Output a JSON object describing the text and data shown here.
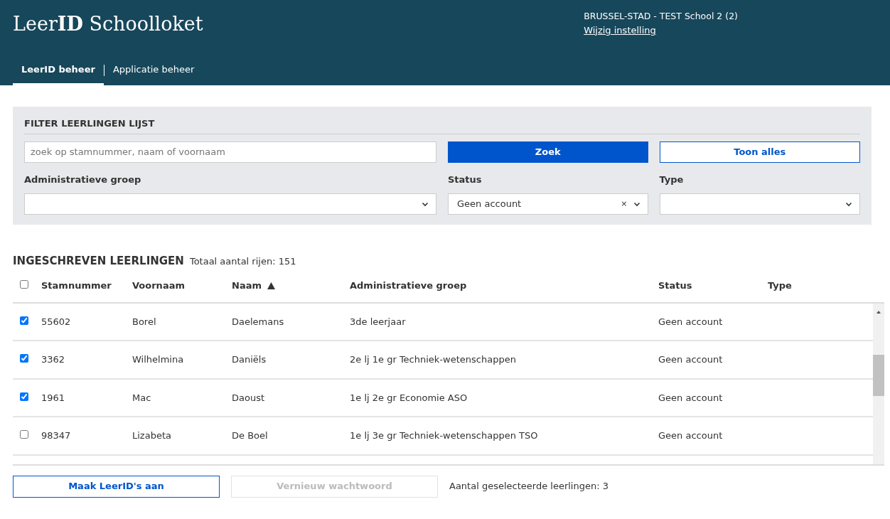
{
  "header": {
    "title": "Leer**ID** Schoolloket",
    "school": "BRUSSEL-STAD - TEST School 2 (2)",
    "change_link": "Wijzig instelling"
  },
  "tabs": [
    {
      "label": "LeerID beheer",
      "selected": true
    },
    {
      "label": "Applicatie beheer",
      "selected": false
    }
  ],
  "filter": {
    "title": "FILTER LEERLINGEN LIJST",
    "search": {
      "placeholder": "zoek op stamnummer, naam of voornaam"
    },
    "search_button": "Zoek",
    "show_all_button": "Toon alles",
    "selects": [
      {
        "label": "Administratieve groep"
      },
      {
        "label": "Status",
        "value": "Geen account",
        "clear": "×"
      },
      {
        "label": "Type"
      }
    ]
  },
  "list": {
    "title": "INGESCHREVEN LEERLINGEN",
    "count": "Totaal aantal rijen: 151",
    "columns": [
      {
        "label": "Stamnummer"
      },
      {
        "label": "Voornaam"
      },
      {
        "label": "Naam",
        "sorted": true
      },
      {
        "label": "Administratieve groep"
      },
      {
        "label": "Status"
      },
      {
        "label": "Type"
      }
    ],
    "select_all": false,
    "rows": [
      {
        "checked": true,
        "cells": [
          "55602",
          "Borel",
          "Daelemans",
          "3de leerjaar",
          "Geen account",
          ""
        ]
      },
      {
        "checked": true,
        "cells": [
          "3362",
          "Wilhelmina",
          "Daniëls",
          "2e lj 1e gr Techniek-wetenschappen",
          "Geen account",
          ""
        ]
      },
      {
        "checked": true,
        "cells": [
          "1961",
          "Mac",
          "Daoust",
          "1e lj 2e gr Economie ASO",
          "Geen account",
          ""
        ]
      },
      {
        "checked": false,
        "cells": [
          "98347",
          "Lizabeta",
          "De Boel",
          "1e lj 3e gr Techniek-wetenschappen TSO",
          "Geen account",
          ""
        ]
      }
    ]
  },
  "footer": {
    "create_button": {
      "label": "Maak LeerID's aan",
      "disabled": false
    },
    "renew_button": {
      "label": "Vernieuw wachtwoord",
      "disabled": true
    },
    "selected_count": "Aantal geselecteerde leerlingen: 3"
  }
}
